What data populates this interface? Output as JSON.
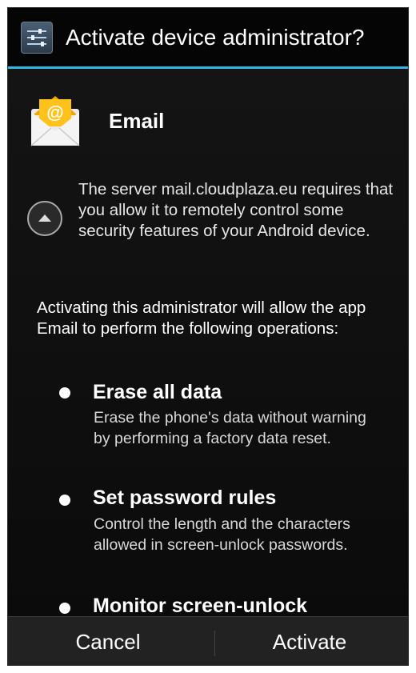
{
  "dialog": {
    "title": "Activate device administrator?",
    "title_icon": "settings-sliders-icon"
  },
  "app": {
    "name": "Email",
    "icon": "email-envelope-icon"
  },
  "server_description": "The server mail.cloudplaza.eu requires that you allow it to remotely control some security features of your Android device.",
  "intro_text": "Activating this administrator will allow the app Email to perform the following operations:",
  "policies": [
    {
      "title": "Erase all data",
      "description": "Erase the phone's data without warning by performing a factory data reset."
    },
    {
      "title": "Set password rules",
      "description": "Control the length and the characters allowed in screen-unlock passwords."
    },
    {
      "title": "Monitor screen-unlock",
      "description": ""
    }
  ],
  "buttons": {
    "cancel": "Cancel",
    "activate": "Activate"
  },
  "colors": {
    "accent": "#33b5e5",
    "background": "#000000",
    "button_bar": "#222222"
  }
}
